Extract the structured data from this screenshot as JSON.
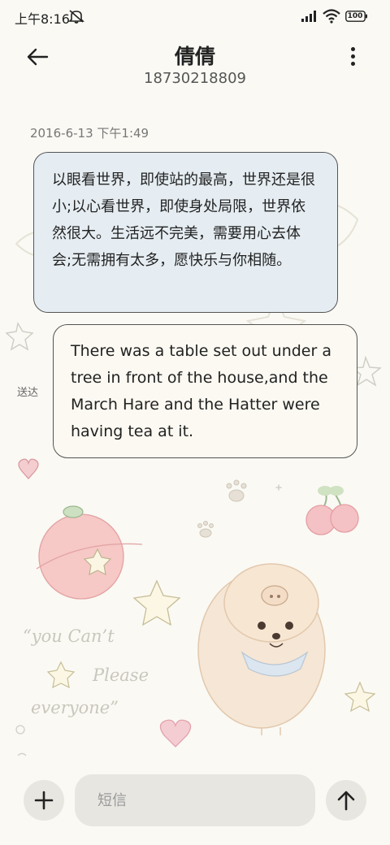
{
  "status_bar": {
    "time": "上午8:16",
    "battery": "100",
    "icons": [
      "mute-icon",
      "signal-icon",
      "wifi-icon",
      "battery-icon"
    ]
  },
  "header": {
    "contact_name": "倩倩",
    "contact_number": "18730218809",
    "back_icon": "arrow-left-icon",
    "more_icon": "more-vertical-icon"
  },
  "conversation": {
    "timestamp": "2016-6-13 下午1:49",
    "messages": [
      {
        "direction": "received",
        "text": "以眼看世界，即使站的最高，世界还是很小;以心看世界，即使身处局限，世界依然很大。生活远不完美，需要用心去体会;无需拥有太多，愿快乐与你相随。"
      },
      {
        "direction": "sent",
        "status": "送达",
        "text": "There was a table set out under a tree in front of the house,and the March Hare and the Hatter were having tea at it."
      }
    ]
  },
  "input_bar": {
    "placeholder": "短信",
    "add_icon": "plus-icon",
    "send_icon": "arrow-up-icon"
  },
  "colors": {
    "background": "#faf9f4",
    "received_bubble": "#e5edf2",
    "sent_bubble": "#fbf9f1",
    "input_bg": "#e7e6e1"
  }
}
